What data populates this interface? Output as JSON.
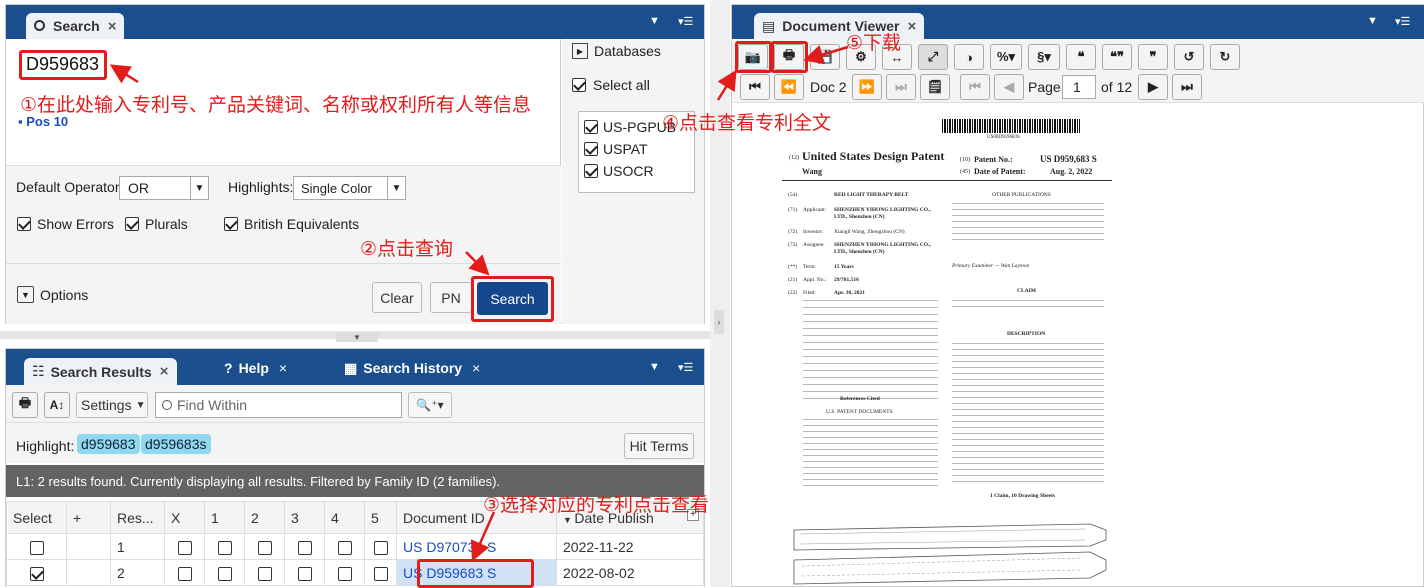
{
  "search_panel": {
    "tab_label": "Search",
    "query": "D959683",
    "example": "Pos 10",
    "databases_label": "Databases",
    "select_all": "Select all",
    "dbs": [
      "US-PGPUB",
      "USPAT",
      "USOCR"
    ],
    "operator_label": "Default Operator:",
    "operator_value": "OR",
    "highlights_label": "Highlights:",
    "highlights_value": "Single Color",
    "show_errors": "Show Errors",
    "plurals": "Plurals",
    "british": "British Equivalents",
    "options": "Options",
    "clear": "Clear",
    "pn": "PN",
    "search": "Search"
  },
  "results_panel": {
    "tabs": [
      "Search Results",
      "Help",
      "Search History"
    ],
    "settings": "Settings",
    "find_placeholder": "Find Within",
    "highlight_label": "Highlight:",
    "terms": [
      "d959683",
      "d959683s"
    ],
    "hit_terms": "Hit Terms",
    "status": "L1: 2 results found. Currently displaying all results. Filtered by Family ID (2 families).",
    "headers": [
      "Select",
      "+",
      "Res...",
      "X",
      "1",
      "2",
      "3",
      "4",
      "5",
      "Document ID",
      "Date Publish"
    ],
    "rows": [
      {
        "n": "1",
        "id": "US D970735 S",
        "date": "2022-11-22"
      },
      {
        "n": "2",
        "id": "US D959683 S",
        "date": "2022-08-02"
      }
    ]
  },
  "viewer": {
    "title": "Document Viewer",
    "doc_label": "Doc 2",
    "page_label": "Page",
    "page_value": "1",
    "of_pages": "of 12",
    "barcode_text": "US00D959683S",
    "patent_title": "United States Design Patent",
    "inventor_short": "Wang",
    "patent_no_label": "Patent No.:",
    "patent_no": "US D959,683 S",
    "date_label": "Date of Patent:",
    "date": "Aug. 2, 2022",
    "field54": "RED LIGHT THERAPY BELT",
    "applicant": "SHENZHEN YIHONG LIGHTING CO., LTD., Shenzhen (CN)",
    "inventor": "Xiangli Wang, Zhengzhou (CN)",
    "assignee": "SHENZHEN YIHONG LIGHTING CO., LTD., Shenzhen (CN)",
    "term": "15 Years",
    "appl_no": "29/781,516",
    "filed": "Apr. 30, 2021",
    "other_pubs": "OTHER PUBLICATIONS",
    "claim": "CLAIM",
    "description": "DESCRIPTION",
    "refs": "References Cited",
    "us_docs": "U.S. PATENT DOCUMENTS",
    "claims_footer": "1 Claim, 10 Drawing Sheets",
    "examiner": "Primary Examiner — Wan Laymon"
  },
  "annotations": {
    "a1": "①在此处输入专利号、产品关键词、名称或权利所有人等信息",
    "a2": "②点击查询",
    "a3": "③选择对应的专利点击查看",
    "a4": "④点击查看专利全文",
    "a5": "⑤下载"
  },
  "colors": {
    "nav": "#1a4e8c",
    "accent": "#e21b1b",
    "search_btn": "#14478b"
  }
}
